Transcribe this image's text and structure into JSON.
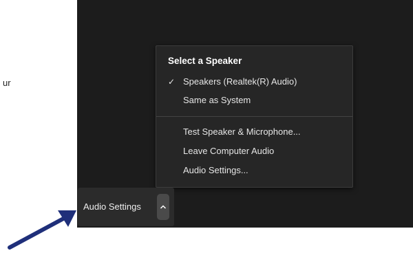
{
  "background_text": "ur",
  "speaker_menu": {
    "heading": "Select a Speaker",
    "speakers": [
      {
        "label": "Speakers (Realtek(R) Audio)",
        "selected": true
      },
      {
        "label": "Same as System",
        "selected": false
      }
    ],
    "actions": [
      {
        "label": "Test Speaker & Microphone..."
      },
      {
        "label": "Leave Computer Audio"
      },
      {
        "label": "Audio Settings..."
      }
    ],
    "check_glyph": "✓"
  },
  "audio_control": {
    "label": "Audio Settings",
    "caret_icon": "chevron-up-icon"
  },
  "annotation": {
    "arrow_color": "#1f2f7a"
  }
}
